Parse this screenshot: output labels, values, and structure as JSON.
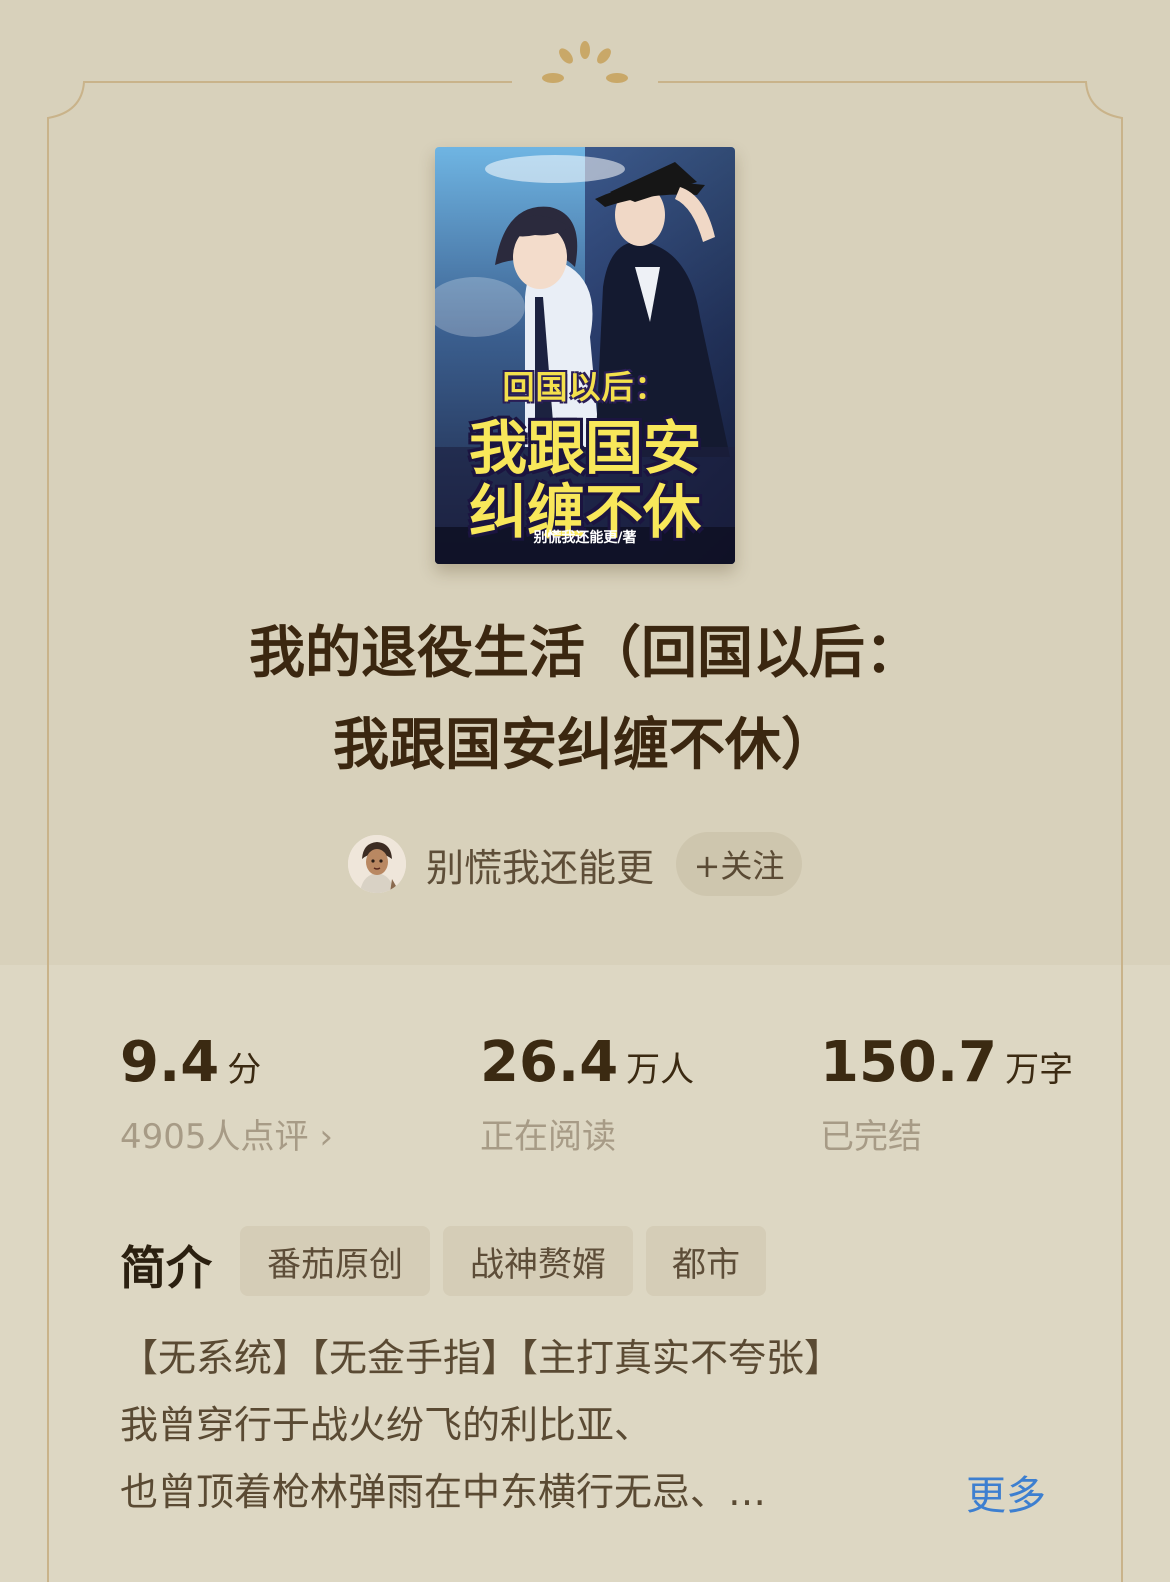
{
  "cover": {
    "title_line1": "回国以后：",
    "title_line2": "我跟国安",
    "title_line3": "纠缠不休",
    "author_credit": "别慌我还能更/著"
  },
  "book": {
    "title_line1": "我的退役生活（回国以后：",
    "title_line2": "我跟国安纠缠不休）"
  },
  "author": {
    "name": "别慌我还能更",
    "follow_label": "+关注"
  },
  "stats": {
    "rating": {
      "value": "9.4",
      "unit": "分",
      "sub": "4905人点评 ›"
    },
    "readers": {
      "value": "26.4",
      "unit": "万人",
      "sub": "正在阅读"
    },
    "words": {
      "value": "150.7",
      "unit": "万字",
      "sub": "已完结"
    }
  },
  "intro": {
    "heading": "简介",
    "tags": [
      "番茄原创",
      "战神赘婿",
      "都市"
    ],
    "lines": [
      "【无系统】【无金手指】【主打真实不夸张】",
      "我曾穿行于战火纷飞的利比亚、",
      "也曾顶着枪林弹雨在中东横行无忌、…"
    ],
    "more_label": "更多"
  },
  "colors": {
    "background": "#d8d1bb",
    "accent_gold": "#c4a66e",
    "title_brown": "#3b2710",
    "link_blue": "#3d7fd0"
  }
}
